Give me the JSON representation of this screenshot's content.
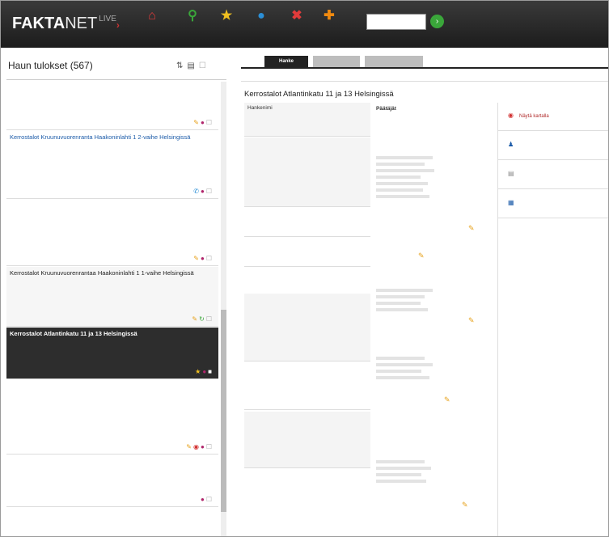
{
  "app": {
    "logo_bold": "FAKTA",
    "logo_light": "NET",
    "logo_live": "LIVE",
    "search_placeholder": "",
    "nav": [
      {
        "label": "",
        "icon": "home-icon",
        "color": "#e23b3b"
      },
      {
        "label": "",
        "icon": "search-icon",
        "color": "#3aa63a"
      },
      {
        "label": "",
        "icon": "star-icon",
        "color": "#f0c020"
      },
      {
        "label": "",
        "icon": "print-icon",
        "color": "#2b8fd6"
      },
      {
        "label": "",
        "icon": "close-icon",
        "color": "#e23b3b"
      },
      {
        "label": "",
        "icon": "plus-icon",
        "color": "#f08a10"
      }
    ],
    "top_links": [
      "",
      "",
      ""
    ]
  },
  "results_panel": {
    "title": "Haun tulokset (567)",
    "subtitle": "",
    "items": [
      {
        "title": "",
        "lines": [
          "",
          "",
          ""
        ],
        "icons": [
          "note-icon",
          "info-icon",
          "checkbox-icon"
        ]
      },
      {
        "title": "Kerrostalot Kruunuvuorenranta Haakoninlahti 1 2-vaihe Helsingissä",
        "lines": [
          "",
          "",
          ""
        ],
        "icons": [
          "phone-icon",
          "info-icon",
          "checkbox-icon"
        ]
      },
      {
        "title": "",
        "lines": [
          "",
          "",
          "",
          ""
        ],
        "icons": [
          "note-icon",
          "info-icon",
          "checkbox-icon"
        ]
      },
      {
        "title": "Kerrostalot Kruunuvuorenrantaa Haakoninlahti 1 1-vaihe Helsingissä",
        "lines": [
          "",
          "",
          ""
        ],
        "icons": [
          "note-icon",
          "refresh-icon",
          "checkbox-icon"
        ]
      },
      {
        "title": "Kerrostalot Atlantinkatu 11 ja 13 Helsingissä",
        "lines": [
          "",
          "",
          ""
        ],
        "icons": [
          "star-icon",
          "info-icon",
          "checkbox-icon"
        ]
      },
      {
        "title": "",
        "lines": [
          "",
          "",
          "",
          ""
        ],
        "icons": [
          "note-icon",
          "pin-icon",
          "info-icon",
          "checkbox-icon"
        ]
      },
      {
        "title": "",
        "lines": [
          "",
          "",
          ""
        ],
        "icons": [
          "info-icon",
          "checkbox-icon"
        ]
      },
      {
        "title": "",
        "lines": [
          ""
        ],
        "icons": []
      }
    ]
  },
  "detail": {
    "tabs": [
      "Hanke",
      "",
      ""
    ],
    "subnav": [
      "",
      "",
      "",
      "",
      "",
      "",
      ""
    ],
    "title": "Kerrostalot Atlantinkatu 11 ja 13 Helsingissä",
    "basic": {
      "heading": "Hankenimi",
      "lines": [
        "",
        ""
      ]
    },
    "address": {
      "heading": "",
      "lines": [
        "",
        "",
        ""
      ],
      "region_label": "",
      "region_value": "",
      "area_label": "",
      "area_value": ""
    },
    "rpt_link": "",
    "dates": [
      {
        "k": "",
        "v": ""
      },
      {
        "k": "",
        "v": ""
      },
      {
        "k": "",
        "v": ""
      }
    ],
    "specs": [
      {
        "k": "",
        "v": ""
      },
      {
        "k": "",
        "v": ""
      },
      {
        "k": "",
        "v": ""
      },
      {
        "k": "",
        "v": ""
      },
      {
        "k": "",
        "v": ""
      },
      {
        "k": "",
        "v": ""
      },
      {
        "k": "",
        "v": ""
      },
      {
        "k": "",
        "v": ""
      },
      {
        "k": "",
        "v": ""
      }
    ],
    "types": {
      "heading": "",
      "rows": [
        {
          "k": "",
          "v": ""
        },
        {
          "k": "",
          "v": ""
        },
        {
          "k": "",
          "v": ""
        }
      ]
    },
    "contact": {
      "heading": "",
      "name": "",
      "lines": [
        "",
        "",
        ""
      ]
    },
    "rpt2": {
      "heading": "",
      "lines": [
        "",
        "",
        "",
        "",
        "",
        ""
      ]
    },
    "parties_heading": "Päätäjät",
    "parties_sub": "",
    "party_date1": "",
    "party_link1": "",
    "party_note1": "",
    "tekijat_heading": "",
    "party_date2": "",
    "party_link2": "",
    "party_note2": "",
    "party_role3": "",
    "party_date3": "",
    "party_link3": "",
    "party_note3": "",
    "party_role4": "",
    "party_date4": "",
    "party_link4": "",
    "party_note4": "",
    "party_role5": "",
    "party_date5": "",
    "party_link5": "",
    "party_note5": "",
    "party_role6": "",
    "side": [
      {
        "label": "Näytä kartalla",
        "icon": "pin-icon",
        "color": "#d23030"
      },
      {
        "label": "",
        "icon": "person-icon",
        "color": "#1a5aa8"
      },
      {
        "label": "",
        "icon": "document-icon",
        "color": "#888888"
      },
      {
        "label": "",
        "icon": "calendar-icon",
        "color": "#1a5aa8"
      }
    ]
  }
}
